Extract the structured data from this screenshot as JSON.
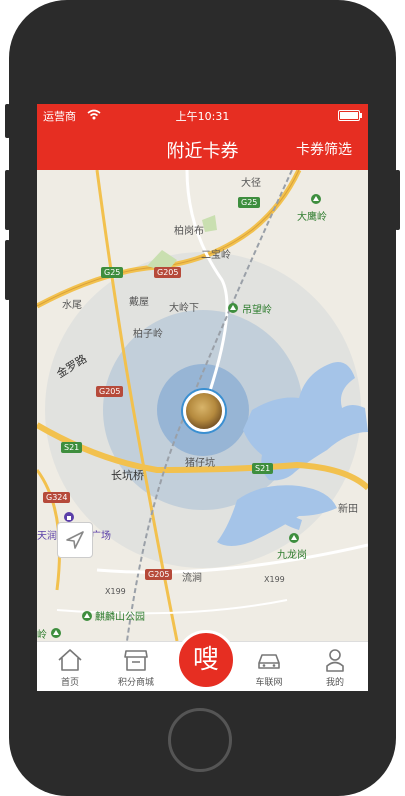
{
  "status_bar": {
    "carrier": "运营商",
    "time": "上午10:31"
  },
  "nav": {
    "title": "附近卡券",
    "filter_label": "卡券筛选"
  },
  "map_labels": {
    "dajing": "大径",
    "baigangbu": "柏岗布",
    "dayingling": "大鹰岭",
    "erbaoling": "二宝岭",
    "shuiwei": "水尾",
    "daiwu": "戴屋",
    "dalingxia": "大岭下",
    "diaowangling": "吊望岭",
    "baiziling": "柏子岭",
    "jinluolu": "金罗路",
    "zhuzaikeng": "猪仔坑",
    "changkengqiao": "长坑桥",
    "xintian": "新田",
    "tianrun": "天润",
    "guangchang": "广场",
    "jiulonggang": "九龙岗",
    "liujian": "流涧",
    "qilinshan": "麒麟山公园",
    "ling": "岭"
  },
  "road_shields": {
    "g25a": "G25",
    "g25b": "G25",
    "g205a": "G205",
    "g205b": "G205",
    "g205c": "G205",
    "s21a": "S21",
    "s21b": "S21",
    "g324": "G324",
    "x199a": "X199",
    "x199b": "X199"
  },
  "tabs": [
    {
      "label": "首页",
      "icon": "home-icon"
    },
    {
      "label": "积分商城",
      "icon": "store-icon"
    },
    {
      "label": "嗖",
      "icon": "center-action"
    },
    {
      "label": "车联网",
      "icon": "car-icon"
    },
    {
      "label": "我的",
      "icon": "user-icon"
    }
  ],
  "colors": {
    "accent": "#e62e22",
    "water": "#a5c4e8",
    "road": "#f2c14e"
  }
}
